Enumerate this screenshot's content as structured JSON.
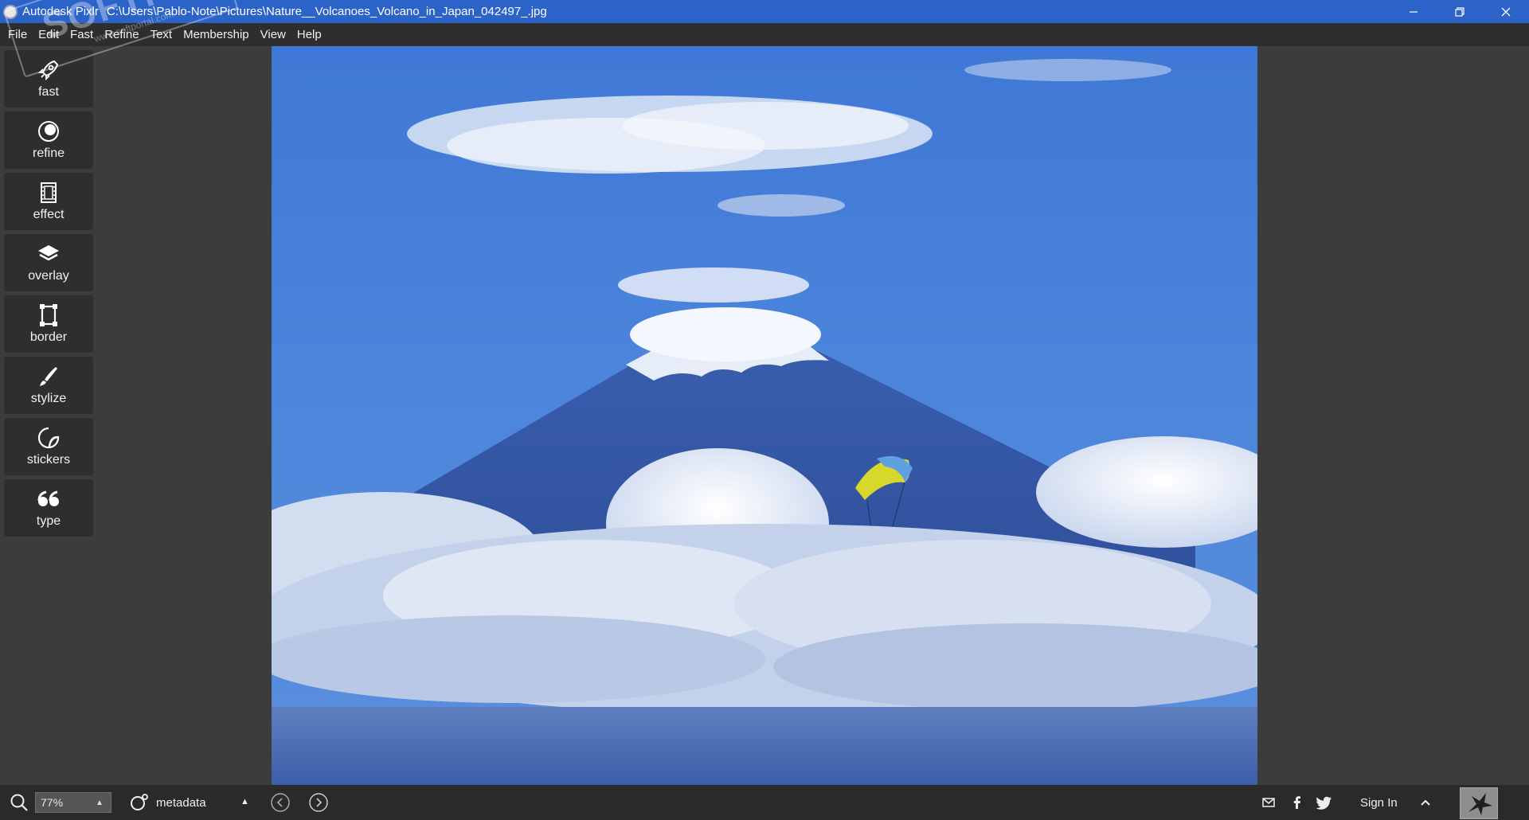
{
  "window": {
    "app_name": "Autodesk Pixlr",
    "file_path": "C:\\Users\\Pablo-Note\\Pictures\\Nature__Volcanoes_Volcano_in_Japan_042497_.jpg",
    "controls": [
      "minimize",
      "restore",
      "close"
    ]
  },
  "menu": {
    "items": [
      "File",
      "Edit",
      "Fast",
      "Refine",
      "Text",
      "Membership",
      "View",
      "Help"
    ]
  },
  "tools": [
    {
      "label": "fast",
      "icon": "rocket-icon"
    },
    {
      "label": "refine",
      "icon": "refine-icon"
    },
    {
      "label": "effect",
      "icon": "film-icon"
    },
    {
      "label": "overlay",
      "icon": "layers-icon"
    },
    {
      "label": "border",
      "icon": "border-icon"
    },
    {
      "label": "stylize",
      "icon": "brush-icon"
    },
    {
      "label": "stickers",
      "icon": "sticker-icon"
    },
    {
      "label": "type",
      "icon": "quote-icon"
    }
  ],
  "watermark": {
    "big": "SOFTPORTAL",
    "small": "www.softportal.com"
  },
  "photo": {
    "subject": "snow-capped volcano above clouds with paraglider"
  },
  "statusbar": {
    "zoom_value": "77%",
    "metadata_label": "metadata",
    "signin_label": "Sign In"
  },
  "colors": {
    "titlebar": "#2b63c8",
    "menubar": "#2e2e2e",
    "workspace": "#3c3c3c",
    "statusbar": "#2a2a2a"
  }
}
